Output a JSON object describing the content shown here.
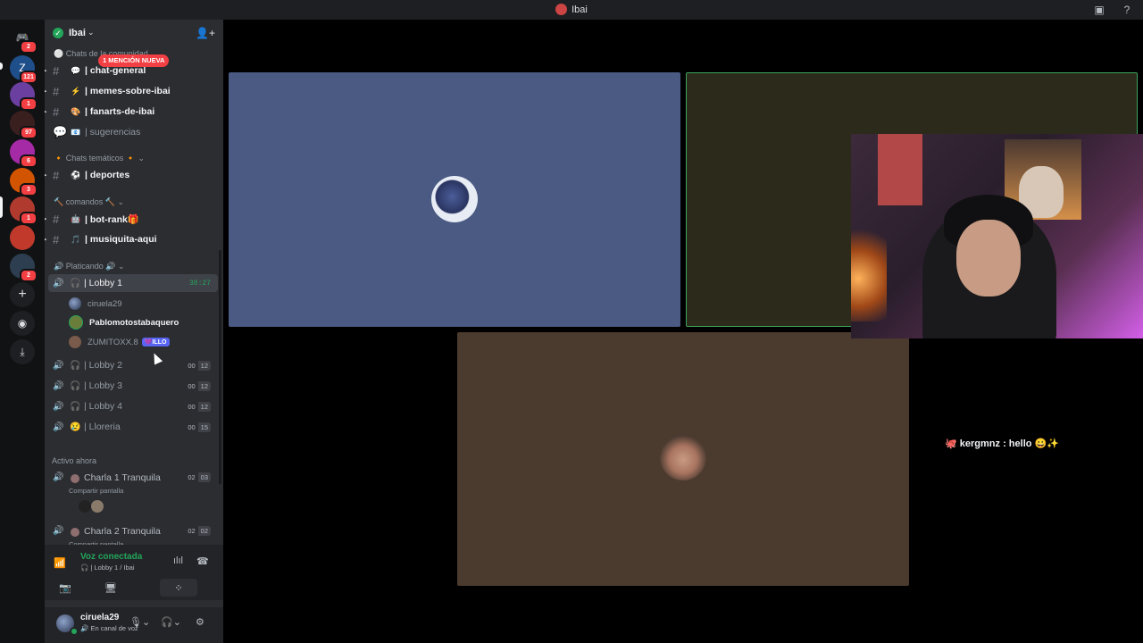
{
  "window": {
    "title": "Ibai"
  },
  "guild": {
    "name": "Ibai",
    "mention_badge": "1 MENCIÓN NUEVA"
  },
  "servers": [
    {
      "badge": "2",
      "color": "#5865f2"
    },
    {
      "badge": "121",
      "color": "#2b6cb0"
    },
    {
      "badge": "1",
      "color": "#6b3fa0"
    },
    {
      "badge": "97",
      "color": "#c0392b"
    },
    {
      "badge": "6",
      "color": "#8e44ad"
    },
    {
      "badge": "3",
      "color": "#d35400"
    },
    {
      "badge": "1",
      "color": "#b03a2e"
    },
    {
      "badge": "",
      "color": "#c0392b"
    },
    {
      "badge": "2",
      "color": "#2c3e50"
    }
  ],
  "categories": {
    "chats": "Chats de la comunidad",
    "tematicos": "Chats temáticos",
    "comandos": "comandos",
    "platicando": "Platicando"
  },
  "text_channels": [
    {
      "emoji": "💬",
      "name": "| chat-general"
    },
    {
      "emoji": "⚡",
      "name": "| memes-sobre-ibai"
    },
    {
      "emoji": "🎨",
      "name": "| fanarts-de-ibai"
    },
    {
      "emoji": "📧",
      "name": "| sugerencias"
    },
    {
      "emoji": "⚽",
      "name": "| deportes"
    },
    {
      "emoji": "🤖",
      "name": "| bot-rank🎁"
    },
    {
      "emoji": "🎵",
      "name": "| musiquita-aqui"
    }
  ],
  "voice_channels": {
    "lobby1": {
      "name": "| Lobby 1",
      "timer": "38:27"
    },
    "lobby2": {
      "name": "| Lobby 2",
      "count": "00",
      "limit": "12"
    },
    "lobby3": {
      "name": "| Lobby 3",
      "count": "00",
      "limit": "12"
    },
    "lobby4": {
      "name": "| Lobby 4",
      "count": "00",
      "limit": "12"
    },
    "lloreria": {
      "name": "| Lloreria",
      "count": "00",
      "limit": "15"
    }
  },
  "members": [
    {
      "name": "ciruela29"
    },
    {
      "name": "Pablomotostabaquero"
    },
    {
      "name": "ZUMITOXX.8",
      "tag": "💜ILLO"
    }
  ],
  "activo": {
    "heading": "Activo ahora",
    "items": [
      {
        "name": "Charla 1 Tranquila",
        "sub": "Compartir pantalla",
        "count": "02",
        "limit": "03"
      },
      {
        "name": "Charla 2 Tranquila",
        "sub": "Compartir pantalla",
        "count": "02",
        "limit": "02"
      }
    ]
  },
  "voice_status": {
    "status": "Voz conectada",
    "location": "| Lobby 1 / Ibai"
  },
  "user": {
    "name": "ciruela29",
    "status": "En canal de voz"
  },
  "stage": {
    "tile1_color": "#4a5a82",
    "tile2_color": "#2b2a1b",
    "tile3_color": "#4b3b2e",
    "speaking_border": "#3ba55c"
  },
  "chat_overlay": {
    "user": "kergmnz",
    "message": ": hello",
    "emotes": "😀✨"
  }
}
